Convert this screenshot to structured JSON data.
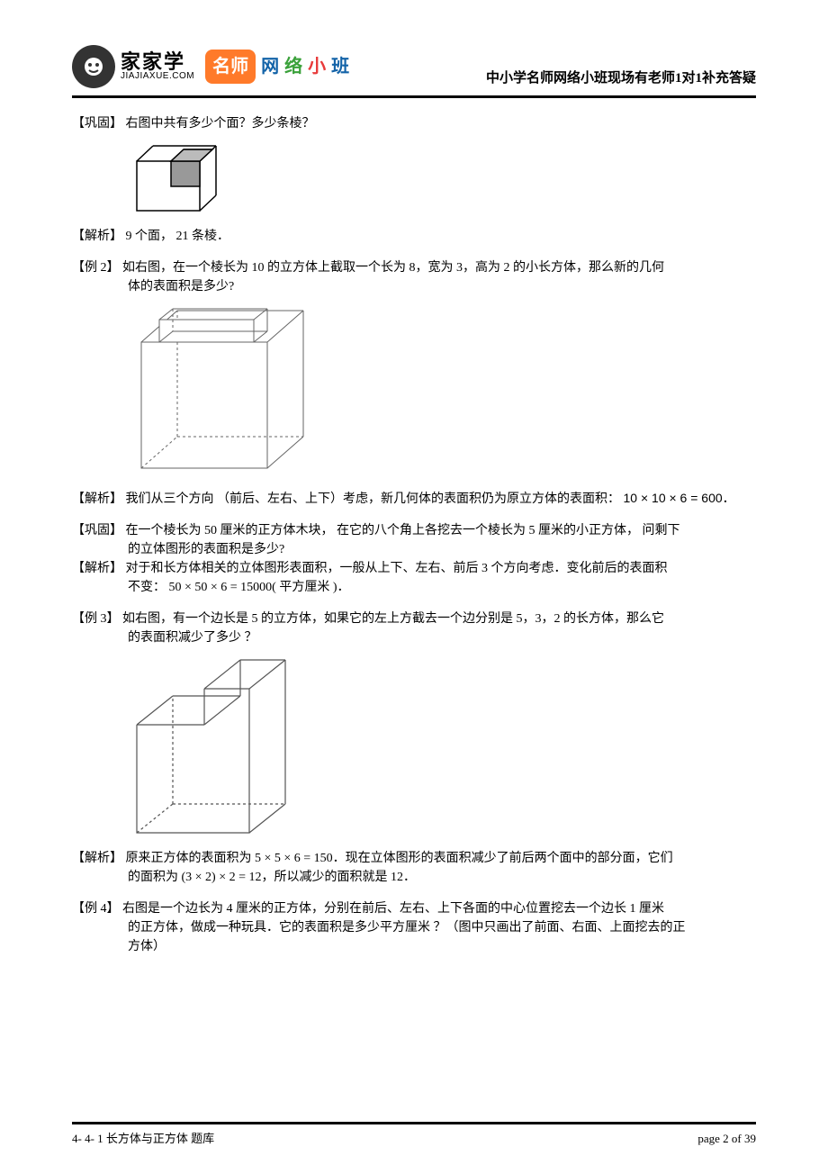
{
  "header": {
    "logo_cn": "家家学",
    "logo_en": "JIAJIAXUE.COM",
    "badge1": "名师",
    "badge2": "网",
    "badge3": "络",
    "badge4": "小",
    "badge5": "班",
    "tagline": "中小学名师网络小班现场有老师1对1补充答疑"
  },
  "q1": {
    "label": "【巩固】",
    "text": "右图中共有多少个面？多少条棱？",
    "ans_label": "【解析】",
    "ans": " 9 个面，  21 条棱．"
  },
  "ex2": {
    "label": "【例  2】",
    "line1": "如右图，在一个棱长为     10 的立方体上截取一个长为     8，宽为  3，高为  2 的小长方体，那么新的几何",
    "line2": "体的表面积是多少?",
    "ans_label": "【解析】",
    "ans_line1": " 我们从三个方向  （前后、左右、上下）考虑，新几何体的表面积仍为原立方体的表面积：",
    "ans_formula": "10 × 10 × 6 = 600．"
  },
  "q2": {
    "label": "【巩固】",
    "line1": " 在一个棱长为    50 厘米的正方体木块，   在它的八个角上各挖去一个棱长为      5 厘米的小正方体，   问剩下",
    "line2": "的立体图形的表面积是多少?",
    "ans_label": "【解析】",
    "ans_line1": " 对于和长方体相关的立体图形表面积，一般从上下、左右、前后        3 个方向考虑．变化前后的表面积",
    "ans_line2": "不变：  50 × 50 × 6 = 15000( 平方厘米  )．"
  },
  "ex3": {
    "label": "【例  3】",
    "line1": "如右图，有一个边长是     5 的立方体，如果它的左上方截去一个边分别是      5，3，2 的长方体，那么它",
    "line2": "的表面积减少了多少    ？",
    "ans_label": "【解析】",
    "ans_line1": " 原来正方体的表面积为      5 × 5 × 6 = 150．现在立体图形的表面积减少了前后两个面中的部分面，它们",
    "ans_line2": "的面积为  (3 × 2) × 2 = 12，所以减少的面积就是     12．"
  },
  "ex4": {
    "label": "【例  4】",
    "line1": "右图是一个边长为    4 厘米的正方体，分别在前后、左右、上下各面的中心位置挖去一个边长         1 厘米",
    "line2": "的正方体，做成一种玩具．它的表面积是多少平方厘米       ？（图中只画出了前面、右面、上面挖去的正",
    "line3": "方体）"
  },
  "footer": {
    "left": "4- 4- 1 长方体与正方体    题库",
    "right": "page 2 of 39"
  }
}
